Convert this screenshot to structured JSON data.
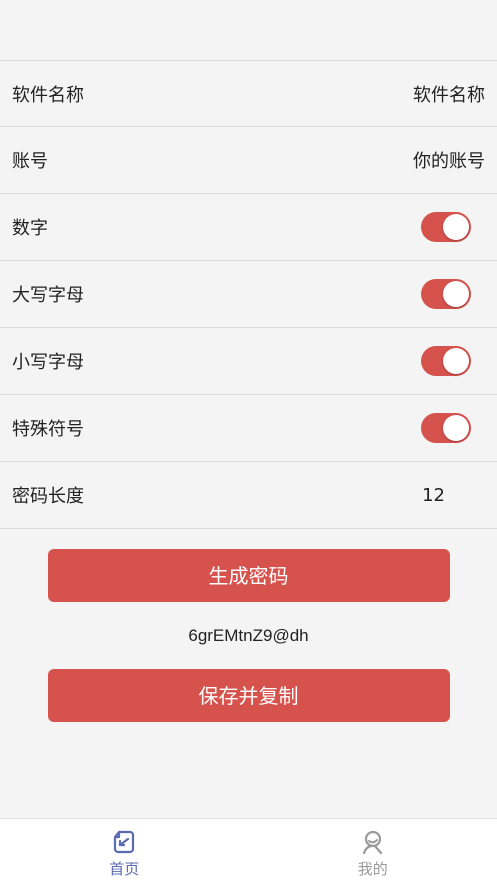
{
  "form": {
    "software_name": {
      "label": "软件名称",
      "value": "软件名称"
    },
    "account": {
      "label": "账号",
      "value": "你的账号"
    },
    "toggles": [
      {
        "label": "数字",
        "on": true
      },
      {
        "label": "大写字母",
        "on": true
      },
      {
        "label": "小写字母",
        "on": true
      },
      {
        "label": "特殊符号",
        "on": true
      }
    ],
    "length": {
      "label": "密码长度",
      "value": "12"
    }
  },
  "actions": {
    "generate_label": "生成密码",
    "save_label": "保存并复制"
  },
  "output": {
    "password": "6grEMtnZ9@dh"
  },
  "tabbar": {
    "home_label": "首页",
    "mine_label": "我的"
  },
  "colors": {
    "accent": "#d6524d",
    "tab_active": "#5a6bb0",
    "tab_inactive": "#9a9a9a"
  }
}
